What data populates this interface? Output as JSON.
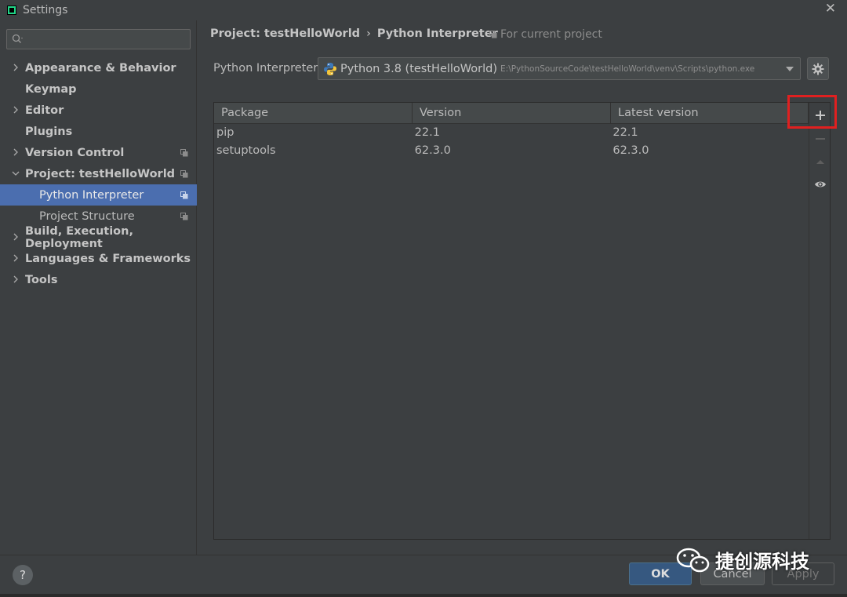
{
  "window": {
    "title": "Settings",
    "close_glyph": "✕"
  },
  "search": {
    "placeholder": "",
    "value": ""
  },
  "sidebar": {
    "items": [
      {
        "label": "Appearance & Behavior"
      },
      {
        "label": "Keymap"
      },
      {
        "label": "Editor"
      },
      {
        "label": "Plugins"
      },
      {
        "label": "Version Control"
      },
      {
        "label": "Project: testHelloWorld"
      },
      {
        "label": "Python Interpreter"
      },
      {
        "label": "Project Structure"
      },
      {
        "label": "Build, Execution, Deployment"
      },
      {
        "label": "Languages & Frameworks"
      },
      {
        "label": "Tools"
      }
    ]
  },
  "breadcrumb": {
    "parent": "Project: testHelloWorld",
    "separator": "›",
    "current": "Python Interpreter",
    "scope": "For current project"
  },
  "interpreter": {
    "label": "Python Interpreter:",
    "name": "Python 3.8 (testHelloWorld)",
    "path": "E:\\PythonSourceCode\\testHelloWorld\\venv\\Scripts\\python.exe"
  },
  "packages": {
    "columns": [
      "Package",
      "Version",
      "Latest version"
    ],
    "rows": [
      {
        "package": "pip",
        "version": "22.1",
        "latest": "22.1"
      },
      {
        "package": "setuptools",
        "version": "62.3.0",
        "latest": "62.3.0"
      }
    ]
  },
  "buttons": {
    "help": "?",
    "ok": "OK",
    "cancel": "Cancel",
    "apply": "Apply"
  },
  "watermark": {
    "text": "捷创源科技"
  },
  "colors": {
    "background": "#3c3f41",
    "selection": "#4b6eaf",
    "ok_button": "#365880",
    "highlight": "#e02020"
  }
}
